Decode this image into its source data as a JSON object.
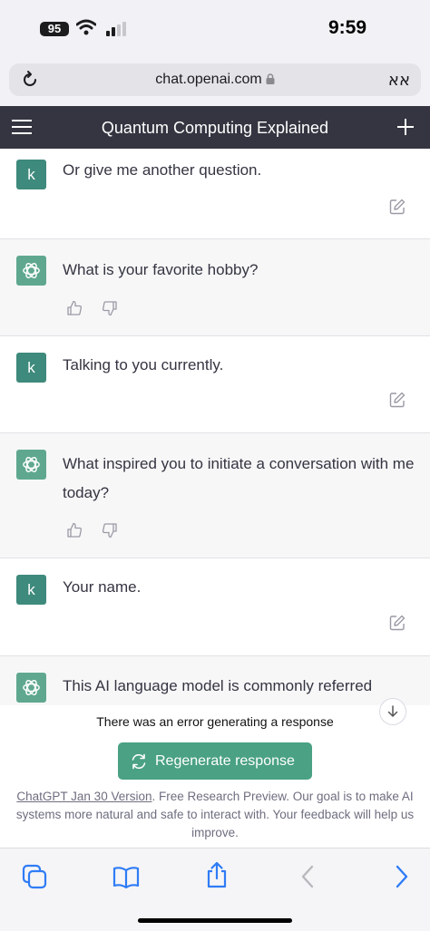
{
  "status_bar": {
    "battery": "95",
    "time": "9:59"
  },
  "browser": {
    "url": "chat.openai.com",
    "reader_label": "אא"
  },
  "header": {
    "title": "Quantum Computing Explained"
  },
  "messages": [
    {
      "role": "user",
      "avatar": "k",
      "text": "Or give me another question."
    },
    {
      "role": "assistant",
      "text": "What is your favorite hobby?"
    },
    {
      "role": "user",
      "avatar": "k",
      "text": "Talking to you currently."
    },
    {
      "role": "assistant",
      "text": "What inspired you to initiate a conversation with me today?"
    },
    {
      "role": "user",
      "avatar": "k",
      "text": "Your name."
    },
    {
      "role": "assistant",
      "text": "This AI language model is commonly referred"
    }
  ],
  "footer": {
    "error": "There was an error generating a response",
    "regenerate_label": "Regenerate response",
    "version_link": "ChatGPT Jan 30 Version",
    "disclaimer": ". Free Research Preview. Our goal is to make AI systems more natural and safe to interact with. Your feedback will help us improve."
  },
  "colors": {
    "header_bg": "#343541",
    "accent": "#4aa183",
    "safari_blue": "#2f7cf6"
  },
  "icons": [
    "wifi-icon",
    "signal-icon",
    "reload-icon",
    "lock-icon",
    "menu-icon",
    "plus-icon",
    "openai-logo-icon",
    "thumbs-up-icon",
    "thumbs-down-icon",
    "edit-icon",
    "arrow-down-icon",
    "regenerate-icon",
    "tabs-icon",
    "bookmarks-icon",
    "share-icon",
    "back-icon",
    "forward-icon"
  ]
}
